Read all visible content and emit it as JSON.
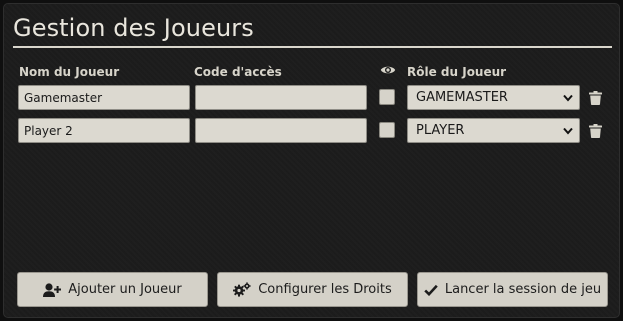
{
  "title": "Gestion des Joueurs",
  "columns": {
    "name": "Nom du Joueur",
    "code": "Code d'accès",
    "role": "Rôle du Joueur",
    "visibility_icon": "eye-icon"
  },
  "players": [
    {
      "name": "Gamemaster",
      "code": "",
      "visible": false,
      "role": "GAMEMASTER"
    },
    {
      "name": "Player 2",
      "code": "",
      "visible": false,
      "role": "PLAYER"
    }
  ],
  "buttons": {
    "add": {
      "label": "Ajouter un Joueur",
      "icon": "user-plus-icon"
    },
    "configure": {
      "label": "Configurer les Droits",
      "icon": "cogs-icon"
    },
    "launch": {
      "label": "Lancer la session de jeu",
      "icon": "check-icon"
    }
  },
  "colors": {
    "background": "#1c1c1c",
    "field": "#dcd9d0",
    "text_light": "#e9e6dd"
  }
}
